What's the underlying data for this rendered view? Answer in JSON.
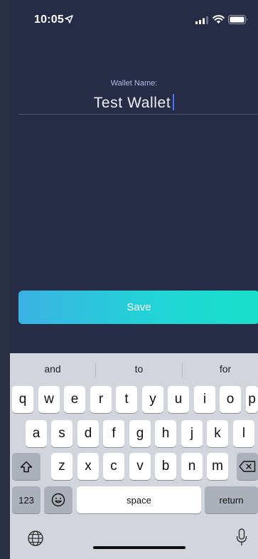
{
  "status": {
    "time": "10:05"
  },
  "icons": {
    "location": "location-arrow-icon",
    "signal": "cellular-signal-icon",
    "wifi": "wifi-icon",
    "battery": "battery-icon",
    "shift": "shift-icon",
    "backspace": "backspace-icon",
    "emoji": "emoji-icon",
    "globe": "globe-icon",
    "mic": "microphone-icon"
  },
  "form": {
    "label": "Wallet Name:",
    "value": "Test Wallet"
  },
  "save_label": "Save",
  "colors": {
    "background": "#262c46",
    "accent_gradient_start": "#3bb2e4",
    "accent_gradient_end": "#18e0cb",
    "caret": "#4a78ff"
  },
  "keyboard": {
    "suggestions": [
      "and",
      "to",
      "for"
    ],
    "row1": [
      "q",
      "w",
      "e",
      "r",
      "t",
      "y",
      "u",
      "i",
      "o",
      "p"
    ],
    "row2": [
      "a",
      "s",
      "d",
      "f",
      "g",
      "h",
      "j",
      "k",
      "l"
    ],
    "row3": [
      "z",
      "x",
      "c",
      "v",
      "b",
      "n",
      "m"
    ],
    "numbers_label": "123",
    "space_label": "space",
    "return_label": "return"
  }
}
